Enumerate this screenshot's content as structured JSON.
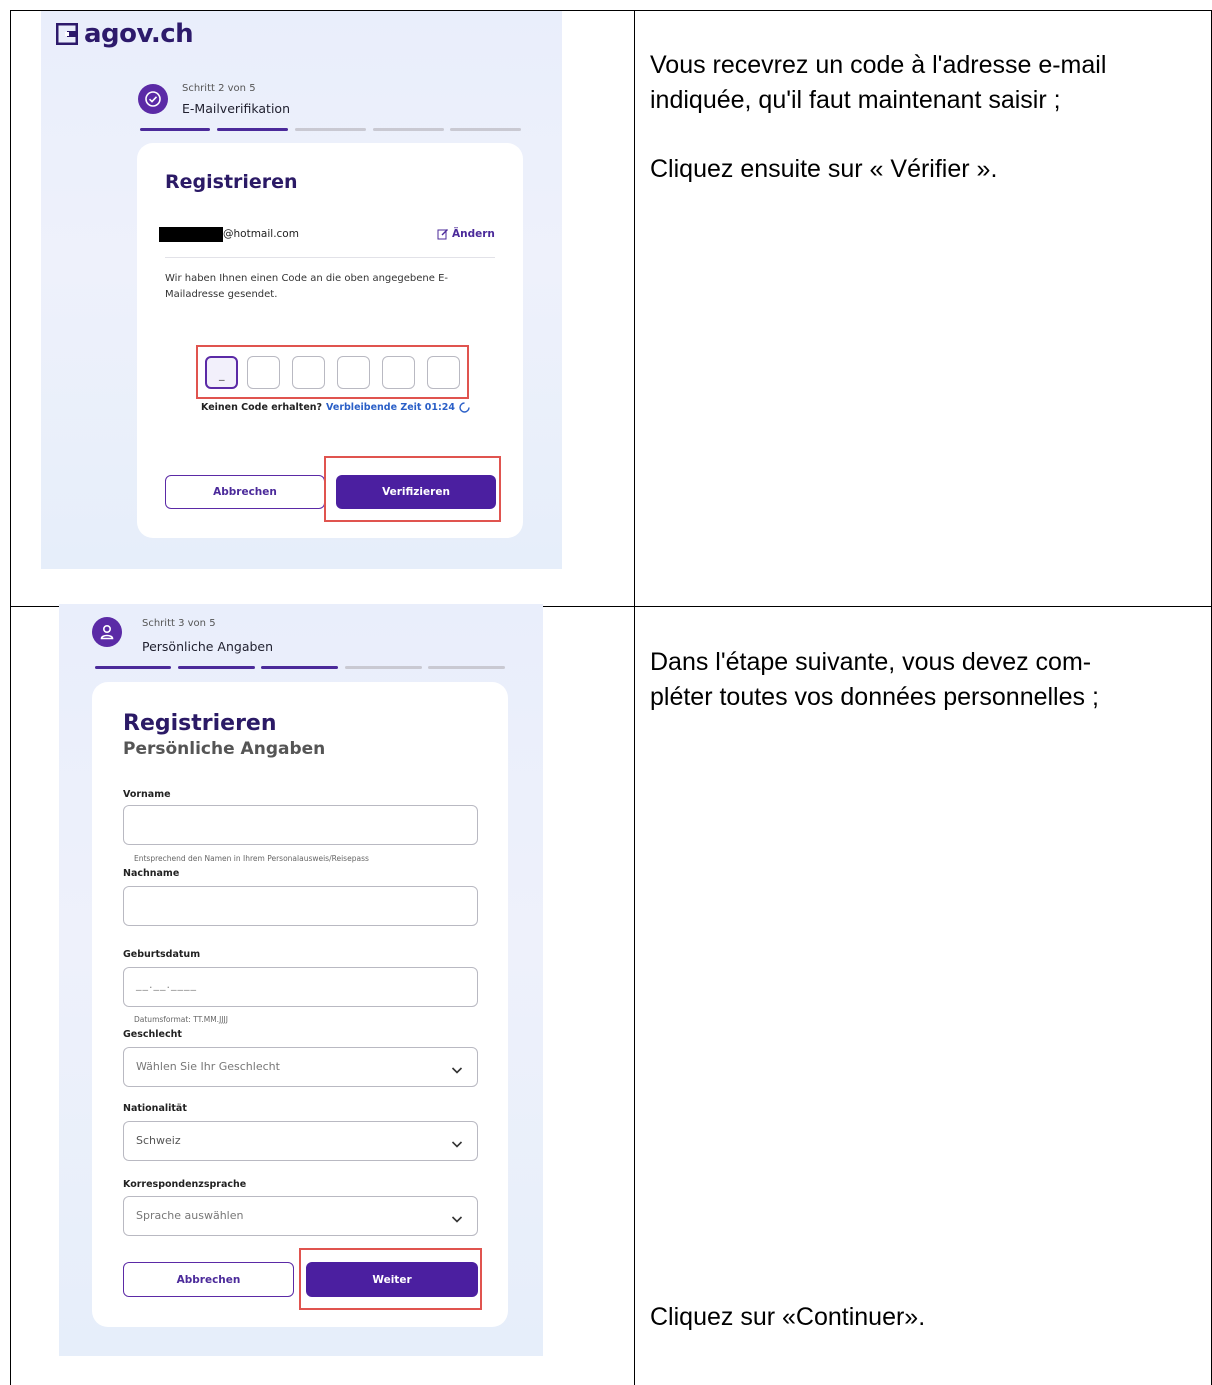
{
  "instructions": {
    "step2_line1": "Vous recevrez un code à l'adresse e-mail",
    "step2_line2": "indiquée, qu'il faut maintenant saisir ;",
    "step2_click": "Cliquez ensuite sur « Vérifier ».",
    "step3_line1": "Dans l'étape suivante, vous devez com-",
    "step3_line2": "pléter toutes vos données personnelles ;",
    "step3_click": "Cliquez sur «Continuer»."
  },
  "screen1": {
    "logo": "agov.ch",
    "step_counter": "Schritt 2 von 5",
    "step_name": "E-Mailverifikation",
    "progress_done_fraction": 0.4,
    "title": "Registrieren",
    "email_suffix": "@hotmail.com",
    "change_label": "Ändern",
    "info_line1": "Wir haben Ihnen einen Code an die oben angegebene E-",
    "info_line2": "Mailadresse gesendet.",
    "code_placeholder": "_",
    "no_code": "Keinen Code erhalten?",
    "remaining": "Verbleibende Zeit 01:24",
    "cancel": "Abbrechen",
    "verify": "Verifizieren"
  },
  "screen2": {
    "step_counter": "Schritt 3 von 5",
    "step_name": "Persönliche Angaben",
    "progress_done_fraction": 0.6,
    "title": "Registrieren",
    "subtitle": "Persönliche Angaben",
    "firstname_label": "Vorname",
    "firstname_hint": "Entsprechend den Namen in Ihrem Personalausweis/Reisepass",
    "lastname_label": "Nachname",
    "birthdate_label": "Geburtsdatum",
    "birthdate_placeholder": "__.__.____",
    "birthdate_hint": "Datumsformat: TT.MM.JJJJ",
    "gender_label": "Geschlecht",
    "gender_placeholder": "Wählen Sie Ihr Geschlecht",
    "nationality_label": "Nationalität",
    "nationality_value": "Schweiz",
    "language_label": "Korrespondenzsprache",
    "language_placeholder": "Sprache auswählen",
    "cancel": "Abbrechen",
    "next": "Weiter"
  },
  "colors": {
    "brand_purple": "#4b1fa0",
    "highlight_red": "#e0544f",
    "link_blue": "#2a5fc7"
  }
}
